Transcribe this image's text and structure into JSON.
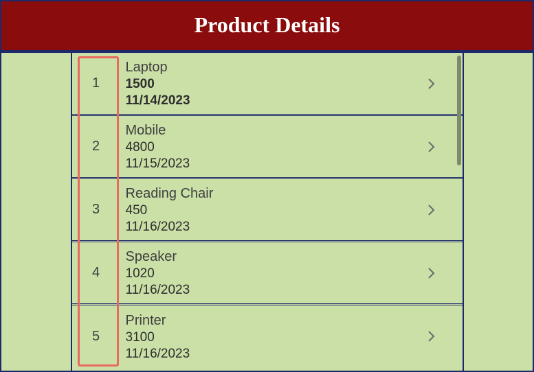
{
  "header": {
    "title": "Product Details"
  },
  "products": [
    {
      "index": "1",
      "name": "Laptop",
      "price": "1500",
      "date": "11/14/2023"
    },
    {
      "index": "2",
      "name": "Mobile",
      "price": "4800",
      "date": "11/15/2023"
    },
    {
      "index": "3",
      "name": "Reading Chair",
      "price": "450",
      "date": "11/16/2023"
    },
    {
      "index": "4",
      "name": "Speaker",
      "price": "1020",
      "date": "11/16/2023"
    },
    {
      "index": "5",
      "name": "Printer",
      "price": "3100",
      "date": "11/16/2023"
    }
  ]
}
